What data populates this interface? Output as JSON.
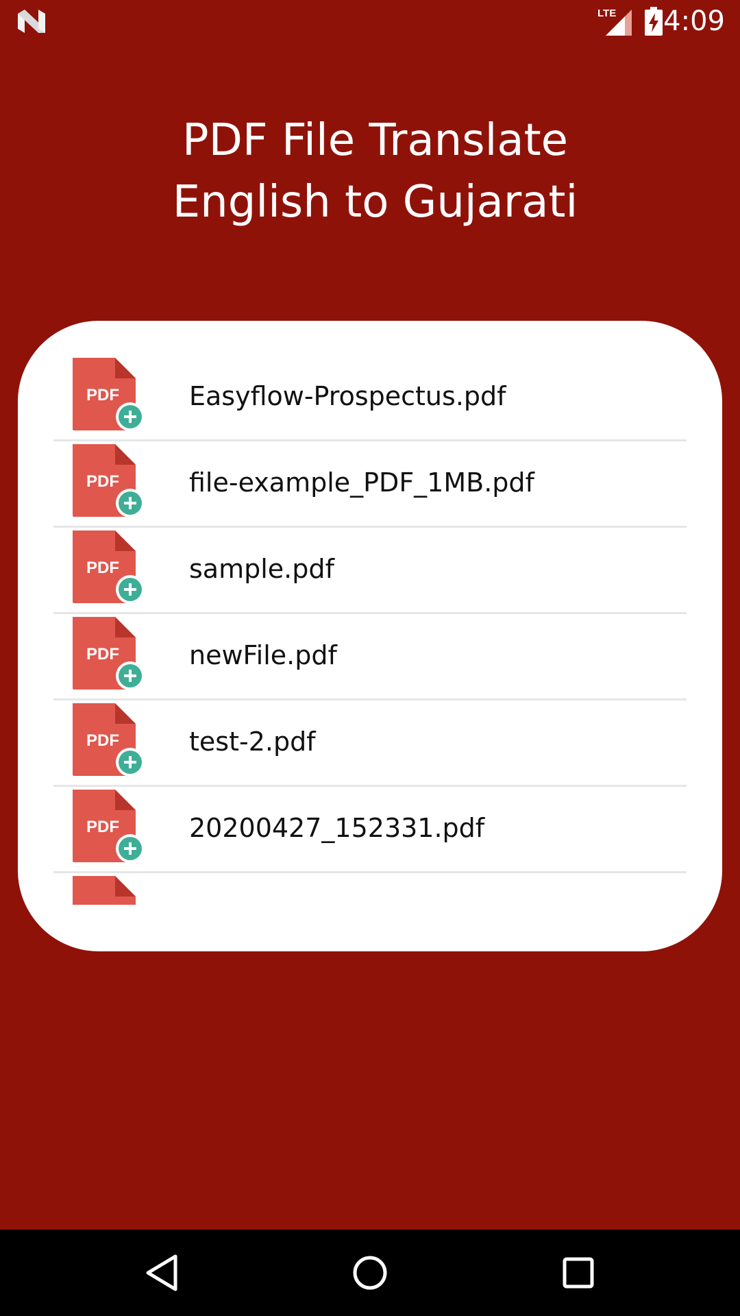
{
  "status_bar": {
    "time": "4:09",
    "network_label": "LTE",
    "icons": [
      "n-logo-icon",
      "lte-signal-icon",
      "battery-charging-icon"
    ]
  },
  "header": {
    "title_line1": "PDF File Translate",
    "title_line2": "English to Gujarati"
  },
  "file_list": {
    "icon_label": "PDF",
    "items": [
      {
        "name": "Easyflow-Prospectus.pdf"
      },
      {
        "name": "file-example_PDF_1MB.pdf"
      },
      {
        "name": "sample.pdf"
      },
      {
        "name": "newFile.pdf"
      },
      {
        "name": "test-2.pdf"
      },
      {
        "name": "20200427_152331.pdf"
      },
      {
        "name": ""
      }
    ]
  },
  "nav_bar": {
    "icons": [
      "back-icon",
      "home-icon",
      "recents-icon"
    ]
  },
  "colors": {
    "background": "#8f1209",
    "card": "#ffffff",
    "pdf_icon_red": "#e0574d",
    "pdf_icon_fold": "#b8352c",
    "add_badge_teal": "#3fae96",
    "divider": "#e6e6e6"
  }
}
